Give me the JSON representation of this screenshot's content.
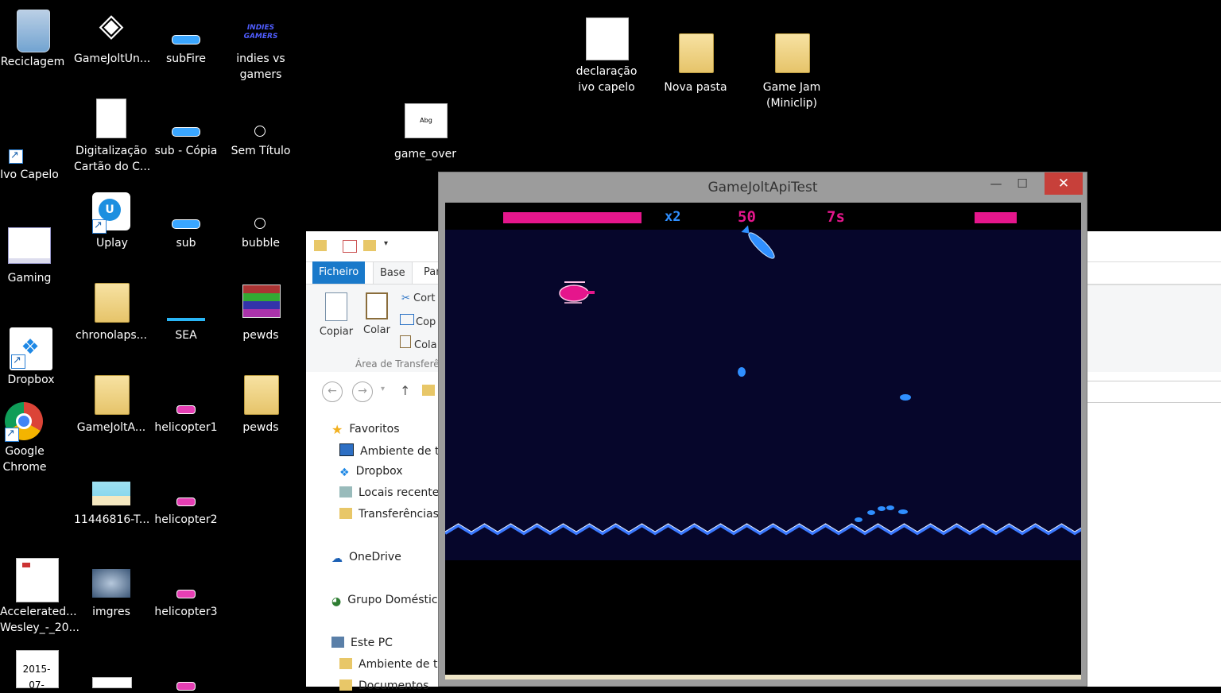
{
  "desktop": {
    "icons": [
      {
        "name": "recycle-bin-icon",
        "line1": "Reciclagem",
        "line2": ""
      },
      {
        "name": "gamejolt-unity-icon",
        "line1": "GameJoltUn...",
        "line2": ""
      },
      {
        "name": "subfire-icon",
        "line1": "subFire",
        "line2": ""
      },
      {
        "name": "indies-vs-gamers-icon",
        "line1": "indies vs",
        "line2": "gamers"
      },
      {
        "name": "digitalizacao-icon",
        "line1": "Digitalização",
        "line2": "Cartão do C..."
      },
      {
        "name": "sub-copia-icon",
        "line1": "sub - Cópia",
        "line2": ""
      },
      {
        "name": "sem-titulo-icon",
        "line1": "Sem Título",
        "line2": ""
      },
      {
        "name": "ivo-capelo-icon",
        "line1": "Ivo Capelo",
        "line2": ""
      },
      {
        "name": "uplay-icon",
        "line1": "Uplay",
        "line2": ""
      },
      {
        "name": "sub-icon",
        "line1": "sub",
        "line2": ""
      },
      {
        "name": "bubble-icon",
        "line1": "bubble",
        "line2": ""
      },
      {
        "name": "gaming-icon",
        "line1": "Gaming",
        "line2": ""
      },
      {
        "name": "chronolaps-icon",
        "line1": "chronolaps...",
        "line2": ""
      },
      {
        "name": "sea-icon",
        "line1": "SEA",
        "line2": ""
      },
      {
        "name": "pewds-rar-icon",
        "line1": "pewds",
        "line2": ""
      },
      {
        "name": "dropbox-icon",
        "line1": "Dropbox",
        "line2": ""
      },
      {
        "name": "gamejolta-folder-icon",
        "line1": "GameJoltA...",
        "line2": ""
      },
      {
        "name": "helicopter1-icon",
        "line1": "helicopter1",
        "line2": ""
      },
      {
        "name": "pewds-folder-icon",
        "line1": "pewds",
        "line2": ""
      },
      {
        "name": "google-chrome-icon",
        "line1": "Google",
        "line2": "Chrome"
      },
      {
        "name": "image-11446816-icon",
        "line1": "11446816-T...",
        "line2": ""
      },
      {
        "name": "helicopter2-icon",
        "line1": "helicopter2",
        "line2": ""
      },
      {
        "name": "accelerated-icon",
        "line1": "Accelerated...",
        "line2": "Wesley_-_20..."
      },
      {
        "name": "imgres-icon",
        "line1": "imgres",
        "line2": ""
      },
      {
        "name": "helicopter3-icon",
        "line1": "helicopter3",
        "line2": ""
      },
      {
        "name": "game-over-icon",
        "line1": "game_over",
        "line2": ""
      },
      {
        "name": "declaracao-icon",
        "line1": "declaração",
        "line2": "ivo capelo"
      },
      {
        "name": "nova-pasta-icon",
        "line1": "Nova pasta",
        "line2": ""
      },
      {
        "name": "game-jam-icon",
        "line1": "Game Jam",
        "line2": "(Miniclip)"
      },
      {
        "name": "doc-2015-icon",
        "line1": "2015-07-",
        "line2": ""
      }
    ],
    "indies_logo_text": "INDIES GAMERS",
    "game_over_thumb_text": "Abg"
  },
  "explorer": {
    "tabs": [
      "Ficheiro",
      "Base",
      "Par"
    ],
    "clipboard": {
      "copy": "Copiar",
      "paste": "Colar",
      "cut": "Cort",
      "copy_path": "Cop",
      "paste_shortcut": "Cola",
      "group": "Área de Transferê"
    },
    "tree": [
      "Favoritos",
      "Ambiente de tr",
      "Dropbox",
      "Locais recentes",
      "Transferências",
      "OneDrive",
      "Grupo Doméstic",
      "Este PC",
      "Ambiente de tr",
      "Documentos"
    ]
  },
  "game_window": {
    "title": "GameJoltApiTest",
    "minimize": "—",
    "maximize": "☐",
    "close": "✕",
    "hud": {
      "multiplier": "x2",
      "score": "50",
      "timer": "7s",
      "health_left_fraction": 0.88,
      "health_right_fraction": 1.0
    },
    "colors": {
      "hud_pink": "#e5168c",
      "hud_blue": "#2f8fff",
      "sea": "#06062b",
      "wave": "#3b79ff"
    }
  }
}
